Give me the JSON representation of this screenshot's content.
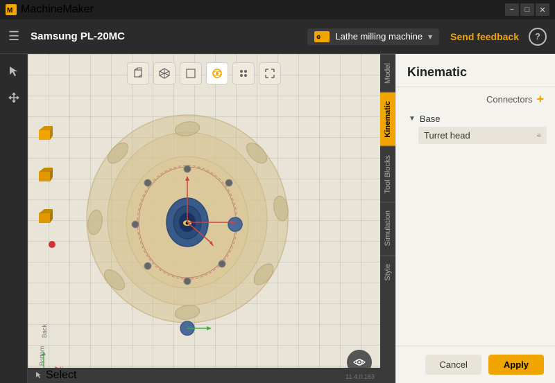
{
  "titlebar": {
    "title": "MachineMaker",
    "controls": [
      "—",
      "□",
      "✕"
    ]
  },
  "header": {
    "title": "Samsung PL-20MC",
    "machine_label": "Lathe milling machine",
    "send_feedback": "Send feedback",
    "help": "?"
  },
  "viewport": {
    "view_buttons": [
      "cube-front",
      "cube-iso",
      "cube-top",
      "sphere-view",
      "dot-view",
      "expand-view"
    ],
    "view_icons": [
      "▣",
      "◧",
      "□",
      "◉",
      "●",
      "⤢"
    ],
    "axis": {
      "x_label": "X",
      "bottom_label": "Bottom",
      "back_label": "Back"
    },
    "select_label": "Select",
    "version": "11.4.0.163"
  },
  "side_tabs": [
    {
      "id": "model",
      "label": "Model"
    },
    {
      "id": "kinematic",
      "label": "Kinematic",
      "active": true
    },
    {
      "id": "tool-blocks",
      "label": "Tool Blocks"
    },
    {
      "id": "simulation",
      "label": "Simulation"
    },
    {
      "id": "style",
      "label": "Style"
    }
  ],
  "panel": {
    "title": "Kinematic",
    "connectors_label": "Connectors",
    "add_icon": "+",
    "tree": {
      "root": {
        "label": "Base",
        "child": "Turret head"
      }
    },
    "cancel_label": "Cancel",
    "apply_label": "Apply"
  }
}
